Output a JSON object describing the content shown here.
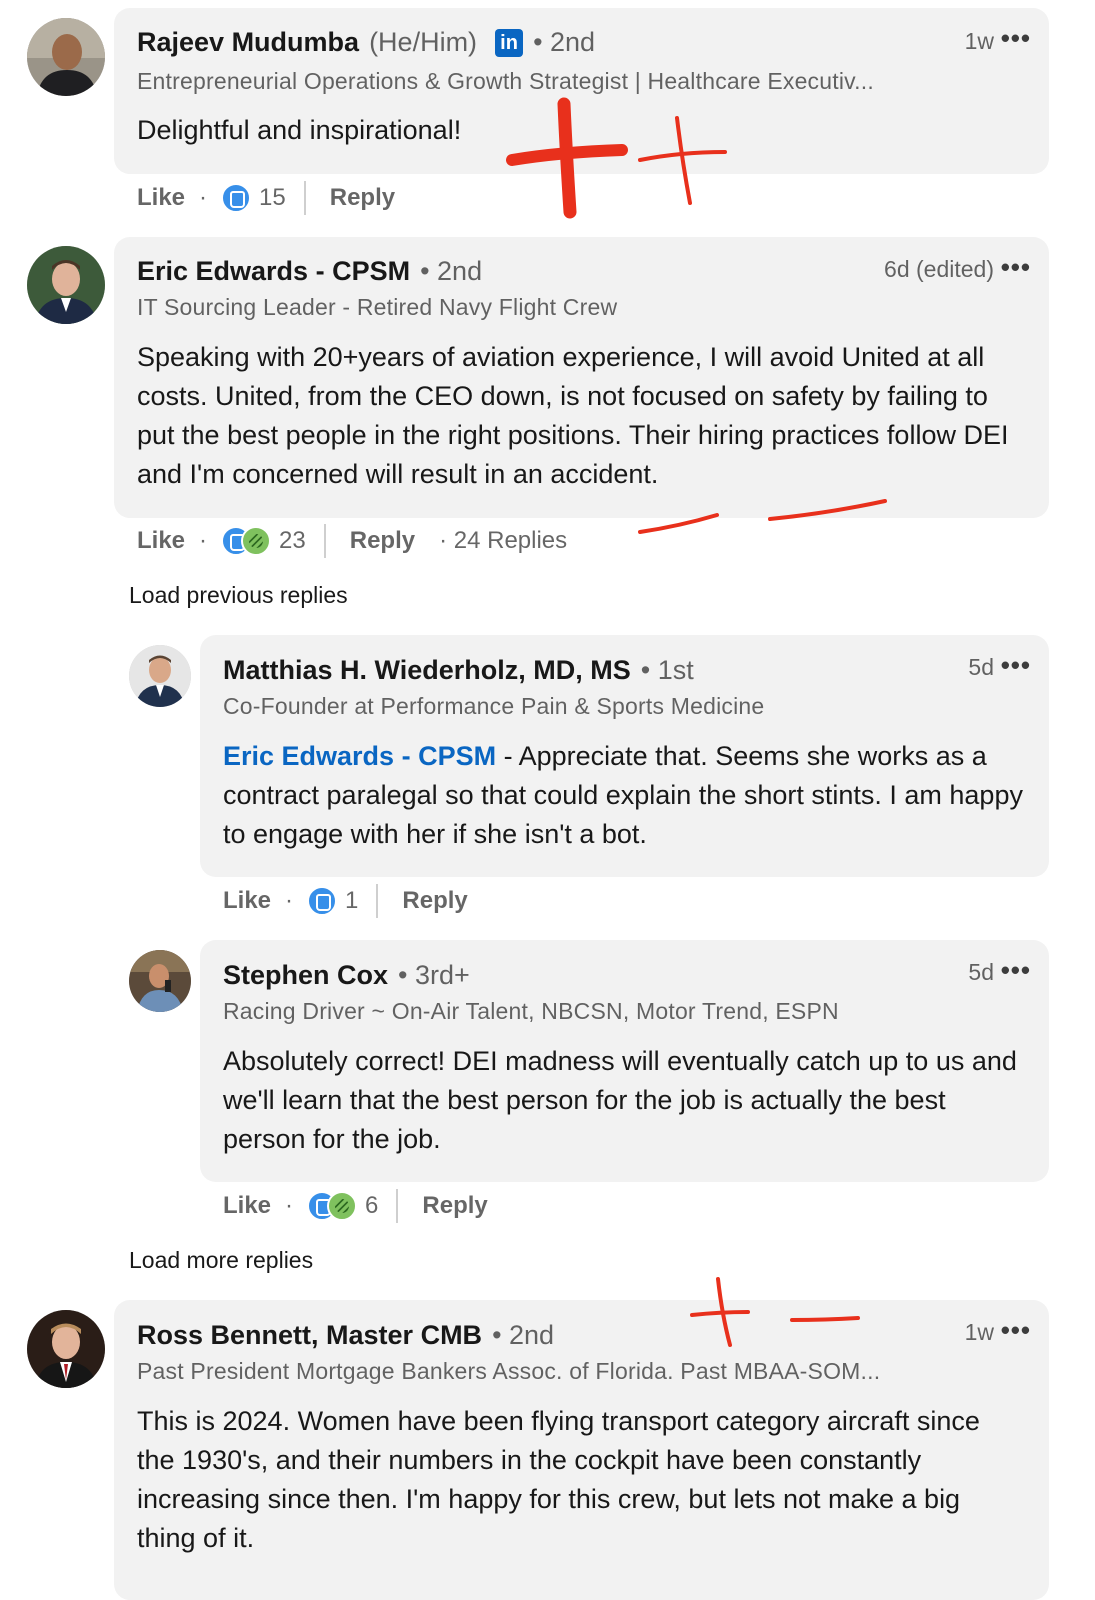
{
  "comments": [
    {
      "name": "Rajeev Mudumba",
      "pronouns": "(He/Him)",
      "badge": "in",
      "degree": "• 2nd",
      "headline": "Entrepreneurial Operations & Growth Strategist | Healthcare Executiv...",
      "time": "1w",
      "text": "Delightful and inspirational!",
      "like_label": "Like",
      "reaction_count": "15",
      "reply_label": "Reply"
    },
    {
      "name": "Eric Edwards - CPSM",
      "degree": "• 2nd",
      "headline": "IT Sourcing Leader - Retired Navy Flight Crew",
      "time": "6d (edited)",
      "text": "Speaking with 20+years of aviation experience, I will avoid United at all costs. United, from the CEO down, is not focused on safety by failing to put the best people in the right positions. Their hiring practices follow DEI and I'm concerned will result in an accident.",
      "like_label": "Like",
      "reaction_count": "23",
      "reply_label": "Reply",
      "replies_label": "· 24 Replies"
    },
    {
      "name": "Ross Bennett, Master CMB",
      "degree": "• 2nd",
      "headline": "Past President Mortgage Bankers Assoc. of Florida. Past MBAA-SOM...",
      "time": "1w",
      "text": "This is 2024. Women have been flying transport category aircraft since the 1930's, and their numbers in the cockpit have been constantly increasing since then. I'm happy for this crew, but lets not make a big thing of it."
    }
  ],
  "load_previous": "Load previous replies",
  "load_more": "Load more replies",
  "replies": [
    {
      "name": "Matthias H. Wiederholz, MD, MS",
      "degree": "• 1st",
      "headline": "Co-Founder at Performance Pain & Sports Medicine",
      "time": "5d",
      "mention": "Eric Edwards - CPSM",
      "text": " - Appreciate that. Seems she works as a contract paralegal so that could explain the short stints. I am happy to engage with her if she isn't a bot.",
      "like_label": "Like",
      "reaction_count": "1",
      "reply_label": "Reply"
    },
    {
      "name": "Stephen Cox",
      "degree": "• 3rd+",
      "headline": "Racing Driver ~ On-Air Talent, NBCSN, Motor Trend, ESPN",
      "time": "5d",
      "text": "Absolutely correct! DEI madness will eventually catch up to us and we'll learn that the best person for the job is actually the best person for the job.",
      "like_label": "Like",
      "reaction_count": "6",
      "reply_label": "Reply"
    }
  ],
  "more_menu": "•••",
  "colors": {
    "bubble": "#f2f2f2",
    "mention": "#0a66c2",
    "annotation": "#e8301c"
  }
}
